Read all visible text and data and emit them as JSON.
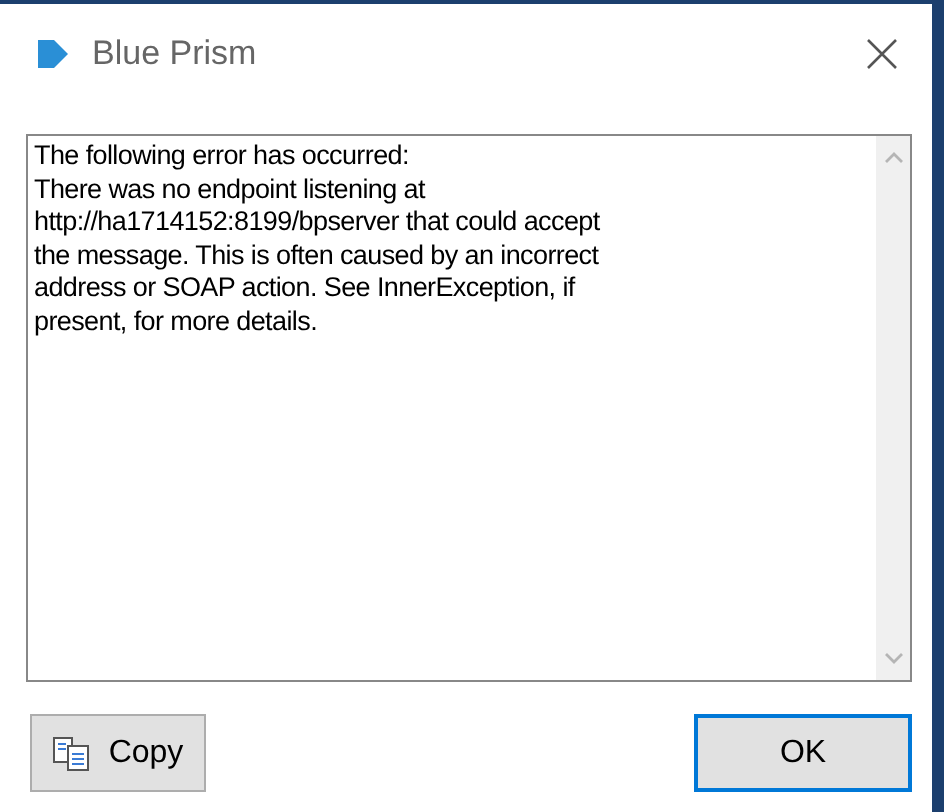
{
  "window": {
    "title": "Blue Prism"
  },
  "message": {
    "lines": [
      "The following error has occurred:",
      "There was no endpoint listening at",
      "http://ha1714152:8199/bpserver that could accept",
      "the message. This is often caused by an incorrect",
      "address or SOAP action. See InnerException, if",
      "present, for more details."
    ]
  },
  "buttons": [
    {
      "label": "Copy",
      "kind": "copy",
      "default": false
    },
    {
      "label": "OK",
      "kind": "plain",
      "default": true
    }
  ]
}
